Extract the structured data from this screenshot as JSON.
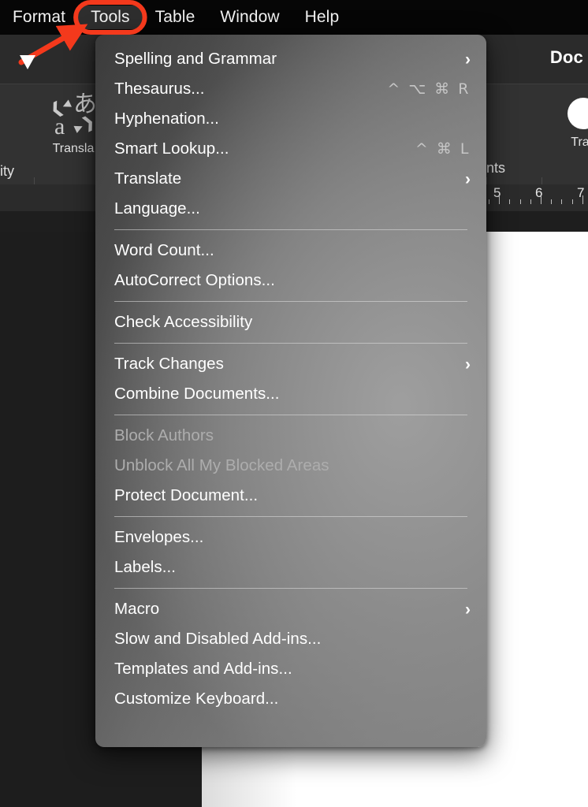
{
  "app": {
    "menubar": [
      {
        "label": "Format",
        "active": false
      },
      {
        "label": "Tools",
        "active": true
      },
      {
        "label": "Table",
        "active": false
      },
      {
        "label": "Window",
        "active": false
      },
      {
        "label": "Help",
        "active": false
      }
    ],
    "document_title_partial": "Doc",
    "ribbon": {
      "accessibility_partial": "lity",
      "translate_label_partial": "Transla",
      "comments_partial": "nents",
      "track_changes_partial": "Trac",
      "translate_icon": "translate-icon",
      "track_changes_icon": "track-changes-circle-icon"
    },
    "ruler": {
      "numbers": [
        "5",
        "6",
        "7"
      ]
    }
  },
  "menu": {
    "title": "Tools",
    "groups": [
      {
        "items": [
          {
            "label": "Spelling and Grammar",
            "shortcut": "",
            "submenu": true,
            "disabled": false
          },
          {
            "label": "Thesaurus...",
            "shortcut": "^ ⌥ ⌘ R",
            "submenu": false,
            "disabled": false
          },
          {
            "label": "Hyphenation...",
            "shortcut": "",
            "submenu": false,
            "disabled": false
          },
          {
            "label": "Smart Lookup...",
            "shortcut": "^ ⌘ L",
            "submenu": false,
            "disabled": false
          },
          {
            "label": "Translate",
            "shortcut": "",
            "submenu": true,
            "disabled": false
          },
          {
            "label": "Language...",
            "shortcut": "",
            "submenu": false,
            "disabled": false
          }
        ]
      },
      {
        "items": [
          {
            "label": "Word Count...",
            "shortcut": "",
            "submenu": false,
            "disabled": false
          },
          {
            "label": "AutoCorrect Options...",
            "shortcut": "",
            "submenu": false,
            "disabled": false
          }
        ]
      },
      {
        "items": [
          {
            "label": "Check Accessibility",
            "shortcut": "",
            "submenu": false,
            "disabled": false
          }
        ]
      },
      {
        "items": [
          {
            "label": "Track Changes",
            "shortcut": "",
            "submenu": true,
            "disabled": false
          },
          {
            "label": "Combine Documents...",
            "shortcut": "",
            "submenu": false,
            "disabled": false
          }
        ]
      },
      {
        "items": [
          {
            "label": "Block Authors",
            "shortcut": "",
            "submenu": false,
            "disabled": true
          },
          {
            "label": "Unblock All My Blocked Areas",
            "shortcut": "",
            "submenu": false,
            "disabled": true
          },
          {
            "label": "Protect Document...",
            "shortcut": "",
            "submenu": false,
            "disabled": false
          }
        ]
      },
      {
        "items": [
          {
            "label": "Envelopes...",
            "shortcut": "",
            "submenu": false,
            "disabled": false
          },
          {
            "label": "Labels...",
            "shortcut": "",
            "submenu": false,
            "disabled": false
          }
        ]
      },
      {
        "items": [
          {
            "label": "Macro",
            "shortcut": "",
            "submenu": true,
            "disabled": false
          },
          {
            "label": "Slow and Disabled Add-ins...",
            "shortcut": "",
            "submenu": false,
            "disabled": false
          },
          {
            "label": "Templates and Add-ins...",
            "shortcut": "",
            "submenu": false,
            "disabled": false
          },
          {
            "label": "Customize Keyboard...",
            "shortcut": "",
            "submenu": false,
            "disabled": false
          }
        ]
      }
    ]
  },
  "annotation": {
    "color": "#F4391C",
    "highlight_target": "Tools",
    "arrow": "pointer-arrow"
  },
  "icons": {
    "submenu_chevron": "chevron-right-icon"
  }
}
